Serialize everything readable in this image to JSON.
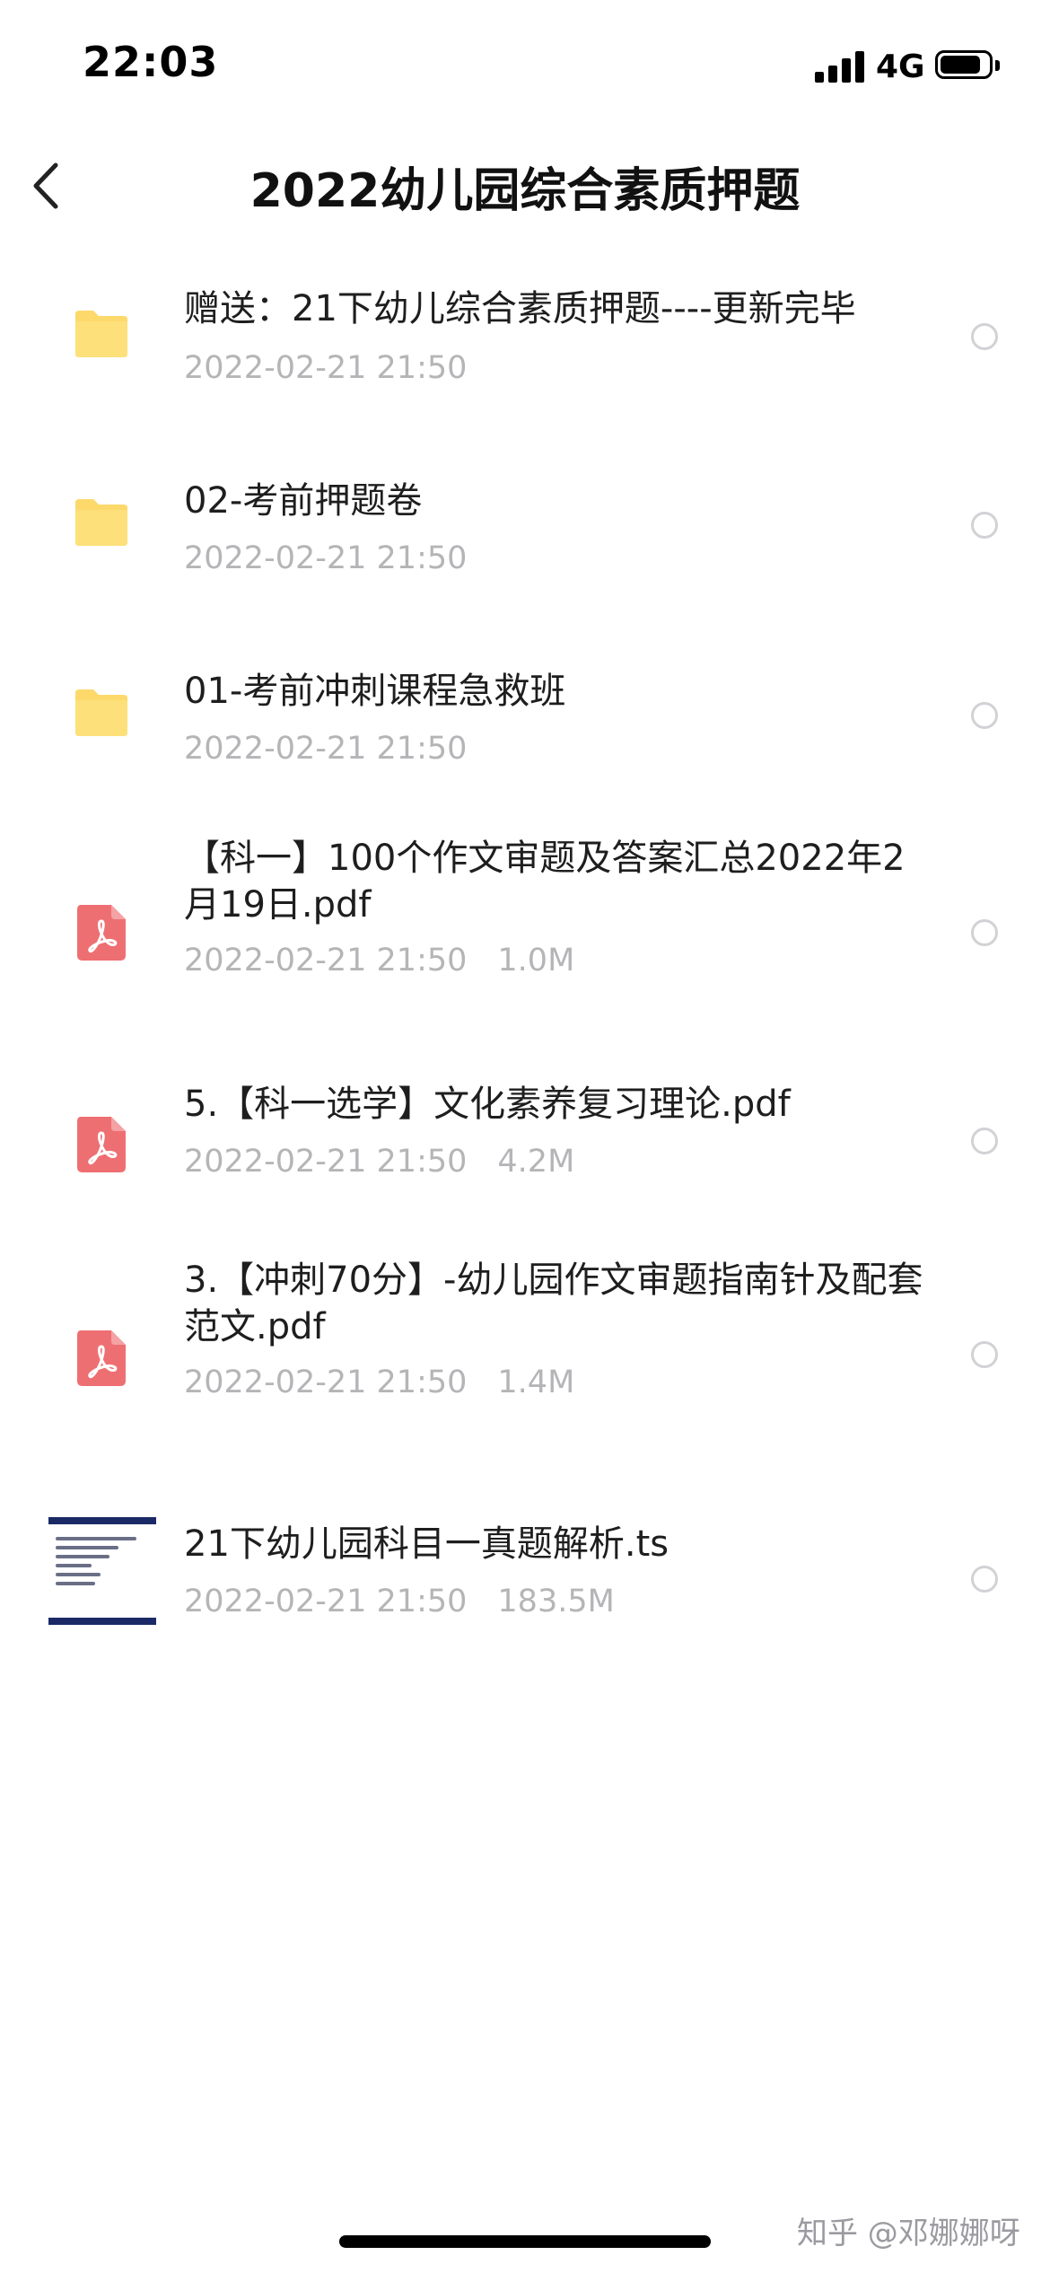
{
  "status_bar": {
    "time": "22:03",
    "network": "4G"
  },
  "header": {
    "title": "2022幼儿园综合素质押题"
  },
  "files": [
    {
      "type": "folder",
      "name": "赠送：21下幼儿综合素质押题----更新完毕",
      "date": "2022-02-21 21:50",
      "size": ""
    },
    {
      "type": "folder",
      "name": "02-考前押题卷",
      "date": "2022-02-21 21:50",
      "size": ""
    },
    {
      "type": "folder",
      "name": "01-考前冲刺课程急救班",
      "date": "2022-02-21 21:50",
      "size": ""
    },
    {
      "type": "pdf",
      "name": "【科一】100个作文审题及答案汇总2022年2月19日.pdf",
      "date": "2022-02-21 21:50",
      "size": "1.0M"
    },
    {
      "type": "pdf",
      "name": "5.【科一选学】文化素养复习理论.pdf",
      "date": "2022-02-21 21:50",
      "size": "4.2M"
    },
    {
      "type": "pdf",
      "name": "3.【冲刺70分】-幼儿园作文审题指南针及配套范文.pdf",
      "date": "2022-02-21 21:50",
      "size": "1.4M"
    },
    {
      "type": "video",
      "name": "21下幼儿园科目一真题解析.ts",
      "date": "2022-02-21 21:50",
      "size": "183.5M"
    }
  ],
  "watermark": "知乎 @邓娜娜呀",
  "colors": {
    "folder": "#FCD96A",
    "pdf": "#EE6F72",
    "meta_text": "#B5B5B8",
    "radio_border": "#D2D2D6"
  }
}
